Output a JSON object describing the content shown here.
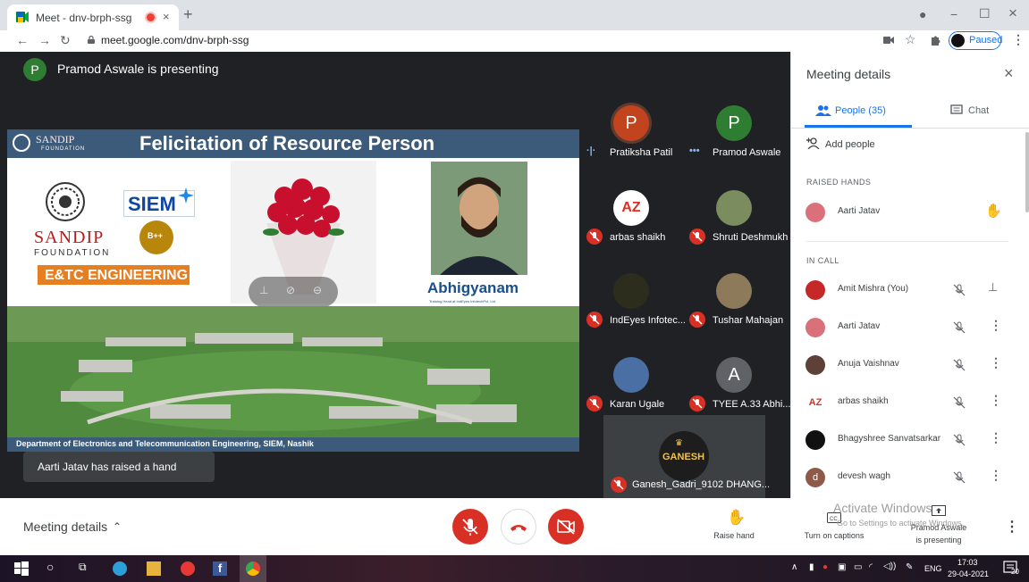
{
  "browser": {
    "tab_title": "Meet - dnv-brph-ssg",
    "new_tab_label": "+",
    "tab_close": "×",
    "url": "meet.google.com/dnv-brph-ssg",
    "profile_status": "Paused",
    "window_controls": {
      "minimize": "−",
      "maximize": "☐",
      "close": "×"
    }
  },
  "stage": {
    "presenter_initial": "P",
    "presenter_banner": "Pramod Aswale is presenting",
    "toast": "Aarti Jatav has raised a hand"
  },
  "slide": {
    "header_logo_name": "SANDIP",
    "header_logo_sub": "FOUNDATION",
    "title": "Felicitation of Resource Person",
    "sandip": "SANDIP",
    "foundation": "FOUNDATION",
    "siem": "SIEM",
    "naac_grade": "B++",
    "department_badge": "E&TC ENGINEERING",
    "guest_brand": "Abhigyanam",
    "guest_caption": "Training Head at IndEyes InfotechPvt. Ltd.",
    "footer": "Department of Electronics and Telecommunication Engineering, SIEM, Nashik"
  },
  "tiles": [
    {
      "name": "Pratiksha Patil",
      "initial": "P",
      "color": "#c1441e",
      "state": "speaking"
    },
    {
      "name": "Pramod Aswale",
      "initial": "P",
      "color": "#2e7d32",
      "state": "presenting"
    },
    {
      "name": "arbas shaikh",
      "initial": "AZ",
      "color": "#ffffff",
      "state": "muted"
    },
    {
      "name": "Shruti Deshmukh",
      "initial": "",
      "color": "#7b8c5f",
      "state": "muted"
    },
    {
      "name": "IndEyes Infotec...",
      "initial": "",
      "color": "#2d2d1e",
      "state": "muted"
    },
    {
      "name": "Tushar Mahajan",
      "initial": "",
      "color": "#8d7a5b",
      "state": "muted"
    },
    {
      "name": "Karan Ugale",
      "initial": "",
      "color": "#4a6fa5",
      "state": "muted"
    },
    {
      "name": "TYEE A.33 Abhi...",
      "initial": "A",
      "color": "#5f6368",
      "state": "muted"
    }
  ],
  "ganesh_tile": {
    "name": "Ganesh_Gadri_9102 DHANG...",
    "logo_text": "GANESH"
  },
  "panel": {
    "title": "Meeting details",
    "close": "×",
    "people_tab": "People (35)",
    "chat_tab": "Chat",
    "add_people": "Add people",
    "raised_hands_label": "RAISED HANDS",
    "raised_hands": [
      {
        "name": "Aarti Jatav",
        "color": "#d9707a"
      }
    ],
    "in_call_label": "IN CALL",
    "in_call": [
      {
        "name": "Amit Mishra (You)",
        "color": "#c62828",
        "action": "pin"
      },
      {
        "name": "Aarti Jatav",
        "color": "#d9707a",
        "action": "more"
      },
      {
        "name": "Anuja Vaishnav",
        "color": "#5d4037",
        "action": "more"
      },
      {
        "name": "arbas shaikh",
        "color": "#ffffff",
        "action": "more"
      },
      {
        "name": "Bhagyshree Sanvatsarkar",
        "color": "#111111",
        "action": "more"
      },
      {
        "name": "devesh wagh",
        "color": "#8d5a4a",
        "initial": "d",
        "action": "more"
      }
    ]
  },
  "bottombar": {
    "meeting_details": "Meeting details",
    "raise_hand": "Raise hand",
    "captions": "Turn on captions",
    "presenting_name": "Pramod Aswale",
    "presenting_status": "is presenting",
    "watermark_title": "Activate Windows",
    "watermark_sub": "Go to Settings to activate Windows."
  },
  "taskbar": {
    "language": "ENG",
    "time": "17:03",
    "date": "29-04-2021",
    "notifications": "20"
  },
  "colors": {
    "accent": "#1a73e8",
    "danger": "#d93025",
    "stage_bg": "#202124",
    "slide_header": "#3c5a7a"
  }
}
